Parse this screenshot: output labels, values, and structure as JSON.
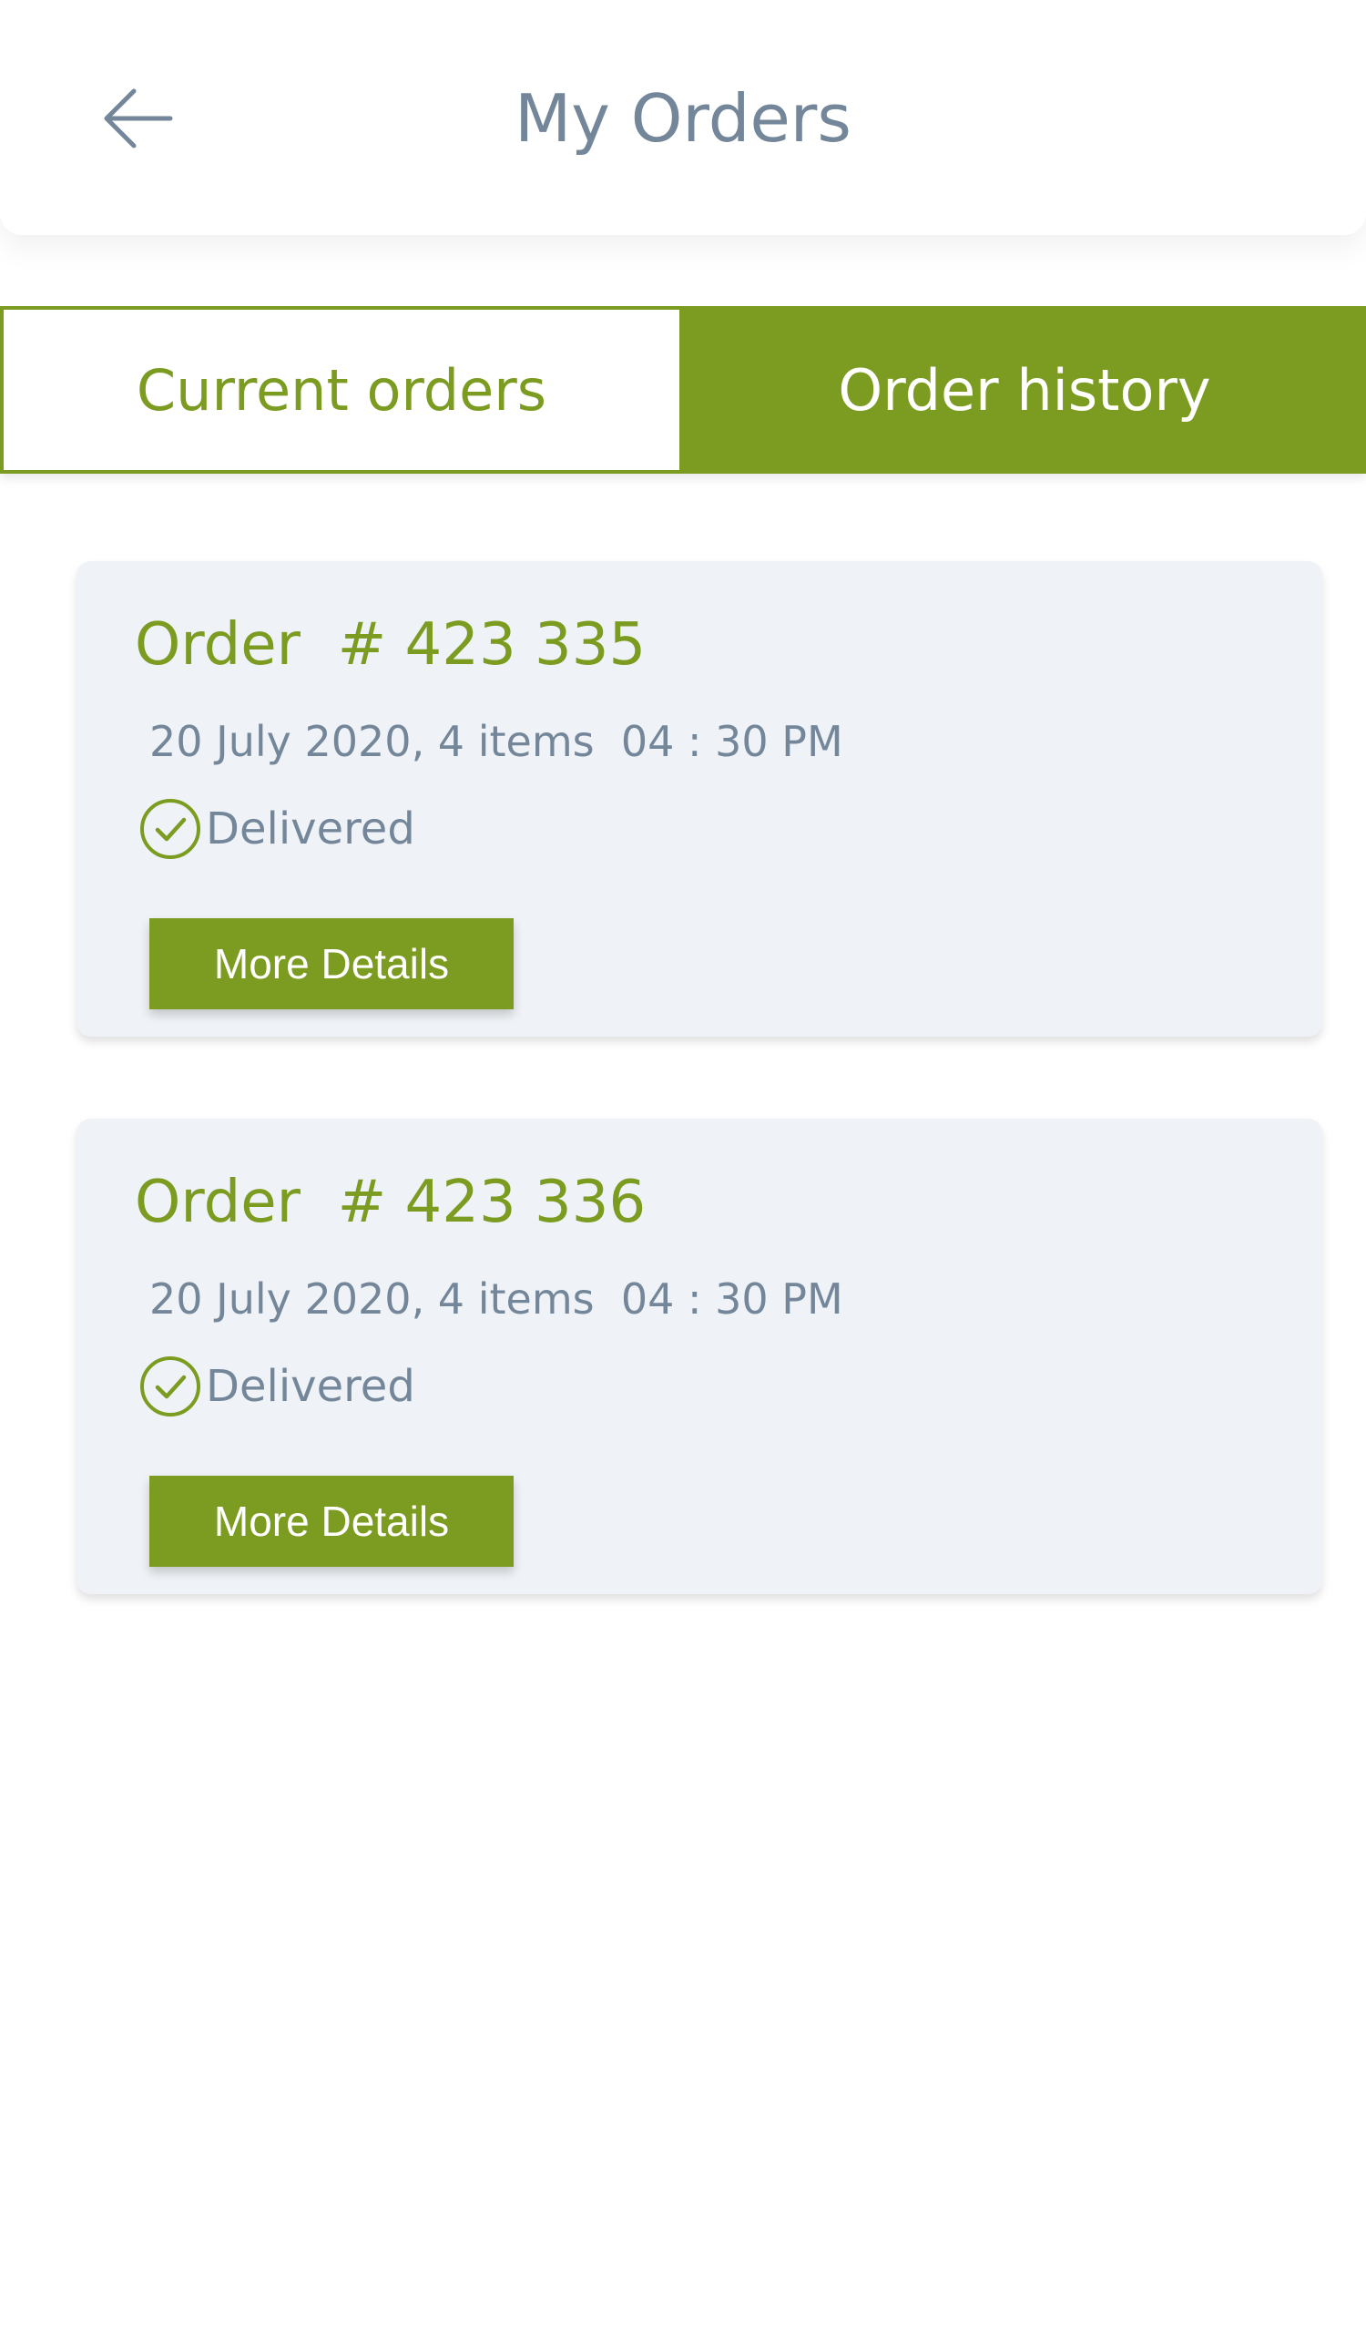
{
  "header": {
    "title": "My Orders",
    "back_icon": "arrow-left-icon"
  },
  "tabs": [
    {
      "label": "Current orders",
      "active": false
    },
    {
      "label": "Order history",
      "active": true
    }
  ],
  "orders": [
    {
      "title": "Order  # 423 335",
      "meta": "20 July 2020, 4 items  04 : 30 PM",
      "status": "Delivered",
      "status_icon": "check-circle-icon",
      "button_label": "More Details"
    },
    {
      "title": "Order  # 423 336",
      "meta": "20 July 2020, 4 items  04 : 30 PM",
      "status": "Delivered",
      "status_icon": "check-circle-icon",
      "button_label": "More Details"
    }
  ],
  "colors": {
    "accent": "#7b9c20",
    "text_muted": "#74879a",
    "card_bg": "#eff2f6"
  }
}
